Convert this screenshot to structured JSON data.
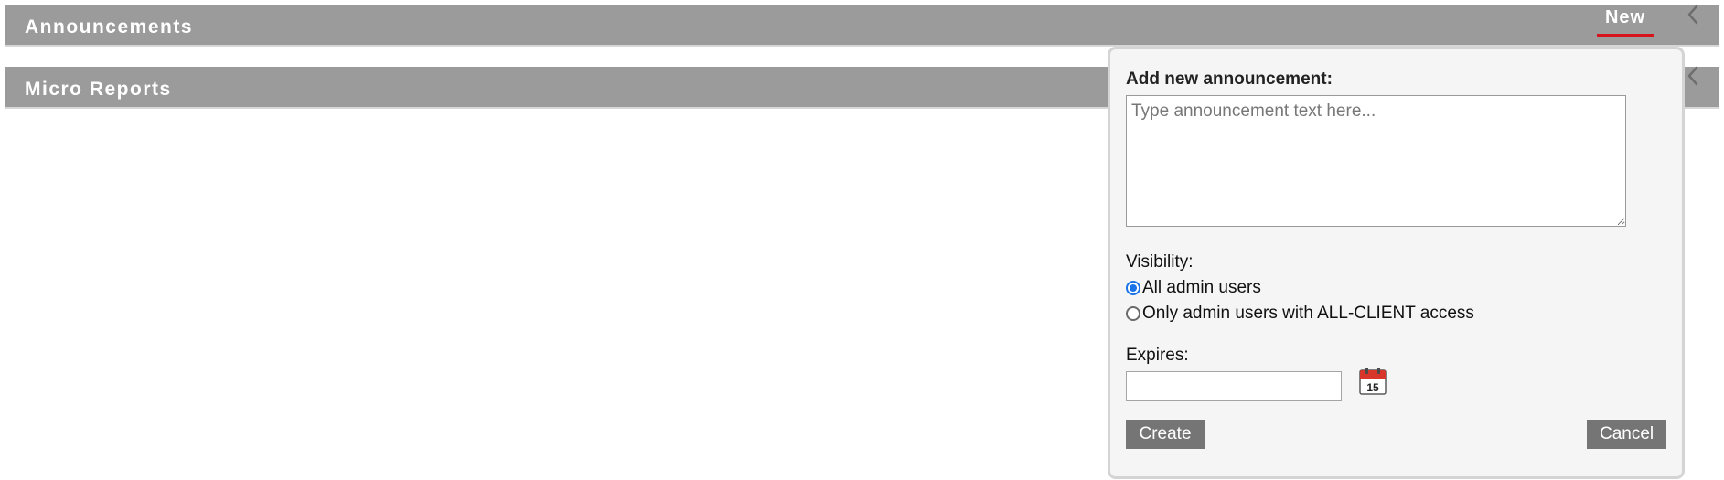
{
  "panels": [
    {
      "title": "Announcements"
    },
    {
      "title": "Micro Reports"
    }
  ],
  "header_actions": {
    "new_label": "New",
    "underline_color": "#d7141c",
    "collapse_icon": "chevron-left-icon"
  },
  "popover": {
    "heading": "Add new announcement:",
    "textarea_placeholder": "Type announcement text here...",
    "textarea_value": "",
    "visibility_label": "Visibility:",
    "visibility_options": [
      {
        "label": "All admin users",
        "selected": true
      },
      {
        "label": "Only admin users with ALL-CLIENT access",
        "selected": false
      }
    ],
    "expires_label": "Expires:",
    "expires_value": "",
    "calendar_icon": "calendar-icon",
    "calendar_day": "15",
    "create_label": "Create",
    "cancel_label": "Cancel"
  },
  "colors": {
    "header_bg": "#9b9b9b",
    "button_bg": "#757575",
    "radio_selected": "#1a73e8",
    "popover_bg": "#f5f5f5"
  }
}
